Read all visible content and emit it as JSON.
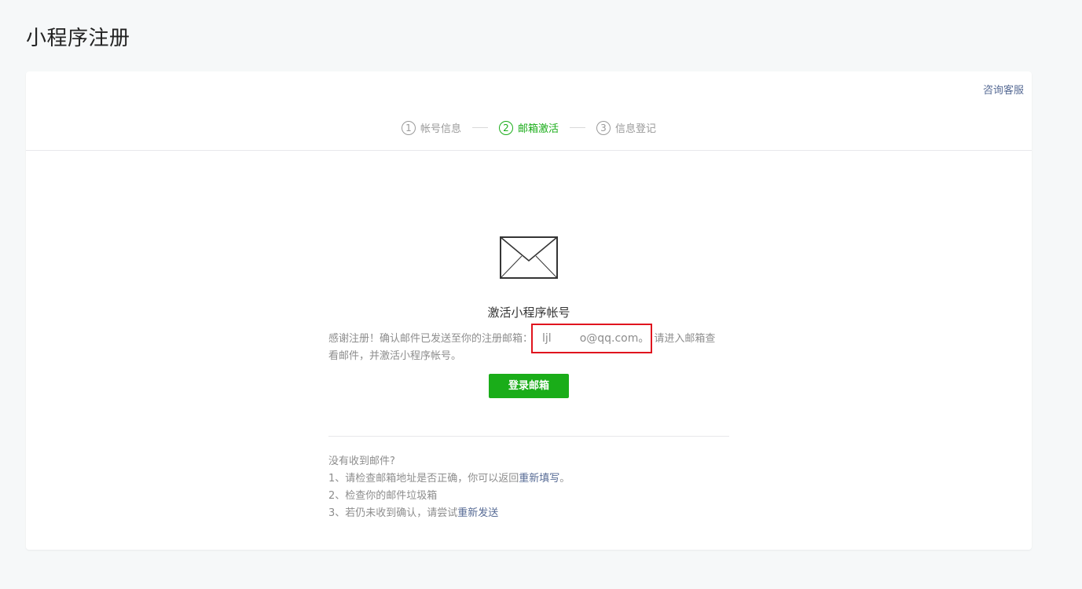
{
  "page_title": "小程序注册",
  "support_link": "咨询客服",
  "steps": [
    {
      "num": "1",
      "label": "帐号信息",
      "active": false
    },
    {
      "num": "2",
      "label": "邮箱激活",
      "active": true
    },
    {
      "num": "3",
      "label": "信息登记",
      "active": false
    }
  ],
  "main": {
    "icon": "mail-icon",
    "title": "激活小程序帐号",
    "desc_prefix": "感谢注册！确认邮件已发送至你的注册邮箱：",
    "email_visible_start": "ljl",
    "email_visible_end": "o@qq.com",
    "email_period": "。",
    "desc_suffix_1": "请进入邮箱查",
    "desc_suffix_2": "看邮件，并激活小程序帐号。",
    "login_button": "登录邮箱"
  },
  "help": {
    "heading": "没有收到邮件?",
    "item1_prefix": "1、请检查邮箱地址是否正确，你可以返回",
    "item1_link": "重新填写",
    "item1_suffix": "。",
    "item2": "2、检查你的邮件垃圾箱",
    "item3_prefix": "3、若仍未收到确认，请尝试",
    "item3_link": "重新发送"
  },
  "colors": {
    "accent_green": "#1aad19",
    "link_blue": "#576b95",
    "highlight_red": "#e0141e"
  }
}
